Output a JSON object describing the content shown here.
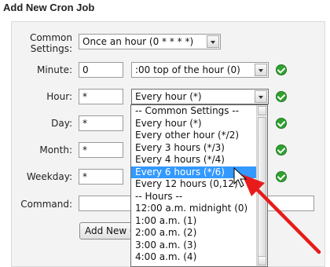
{
  "page": {
    "title": "Add New Cron Job"
  },
  "form": {
    "common_settings": {
      "label": "Common Settings:",
      "value": "Once an hour (0 * * * *)"
    },
    "minute": {
      "label": "Minute:",
      "value": "0",
      "select_value": ":00 top of the hour (0)"
    },
    "hour": {
      "label": "Hour:",
      "value": "*",
      "select_value": "Every hour (*)"
    },
    "day": {
      "label": "Day:",
      "value": "*"
    },
    "month": {
      "label": "Month:",
      "value": "*"
    },
    "weekday": {
      "label": "Weekday:",
      "value": "*"
    },
    "command": {
      "label": "Command:",
      "value": ""
    },
    "submit": {
      "label": "Add New Cron Job"
    }
  },
  "hour_dropdown": {
    "options": [
      "-- Common Settings --",
      "Every hour (*)",
      "Every other hour (*/2)",
      "Every 3 hours (*/3)",
      "Every 4 hours (*/4)",
      "Every 6 hours (*/6)",
      "Every 12 hours (0,12)",
      "-- Hours --",
      "12:00 a.m. midnight (0)",
      "1:00 a.m. (1)",
      "2:00 a.m. (2)",
      "3:00 a.m. (3)",
      "4:00 a.m. (4)"
    ],
    "highlighted_option": "Every 6 hours (*/6)"
  },
  "colors": {
    "highlight": "#3399ff",
    "check": "#2fa12f",
    "annotation_arrow": "#e81b1b"
  },
  "icons": {
    "status": "check-circle-icon",
    "pointer": "mouse-cursor-icon",
    "annotation": "red-arrow-annotation"
  }
}
